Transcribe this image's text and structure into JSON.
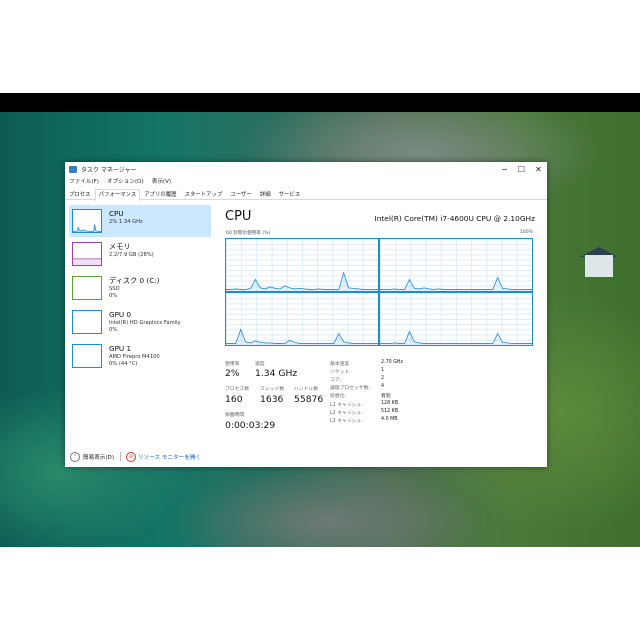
{
  "window": {
    "title": "タスク マネージャー",
    "controls": {
      "minimize": "─",
      "maximize": "☐",
      "close": "✕"
    }
  },
  "menu": [
    "ファイル(F)",
    "オプション(O)",
    "表示(V)"
  ],
  "tabs": [
    {
      "label": "プロセス",
      "active": false
    },
    {
      "label": "パフォーマンス",
      "active": true
    },
    {
      "label": "アプリの履歴",
      "active": false
    },
    {
      "label": "スタートアップ",
      "active": false
    },
    {
      "label": "ユーザー",
      "active": false
    },
    {
      "label": "詳細",
      "active": false
    },
    {
      "label": "サービス",
      "active": false
    }
  ],
  "sidebar": [
    {
      "name": "CPU",
      "line1": "2%  1.34 GHz",
      "line2": "",
      "color": "#1f8bd1"
    },
    {
      "name": "メモリ",
      "line1": "2.2/7.9 GB (28%)",
      "line2": "",
      "color": "#a23fb0"
    },
    {
      "name": "ディスク 0 (C:)",
      "line1": "SSD",
      "line2": "0%",
      "color": "#5aa33a"
    },
    {
      "name": "GPU 0",
      "line1": "Intel(R) HD Graphics Family",
      "line2": "0%",
      "color": "#1f8bd1"
    },
    {
      "name": "GPU 1",
      "line1": "AMD Firepro M4100",
      "line2": "0% (44 °C)",
      "color": "#1f8bd1"
    }
  ],
  "main": {
    "title": "CPU",
    "model": "Intel(R) Core(TM) i7-4600U CPU @ 2.10GHz",
    "usage_label": "60 秒間の使用率 (%)",
    "usage_max": "100%",
    "graphs": [
      [
        3,
        3,
        4,
        3,
        3,
        5,
        22,
        6,
        4,
        8,
        5,
        4,
        10,
        6,
        4,
        5,
        4,
        3,
        3,
        4,
        3,
        3,
        3,
        3,
        35,
        6,
        5,
        4,
        3,
        3,
        3,
        3
      ],
      [
        3,
        3,
        3,
        4,
        3,
        3,
        22,
        5,
        4,
        6,
        4,
        3,
        4,
        3,
        3,
        3,
        3,
        3,
        3,
        3,
        3,
        3,
        3,
        3,
        26,
        5,
        4,
        3,
        3,
        3,
        3,
        3
      ],
      [
        3,
        3,
        3,
        30,
        6,
        4,
        8,
        5,
        4,
        4,
        3,
        3,
        3,
        9,
        5,
        3,
        3,
        3,
        3,
        3,
        3,
        3,
        3,
        22,
        6,
        4,
        3,
        3,
        3,
        3,
        3,
        3
      ],
      [
        3,
        3,
        3,
        4,
        3,
        3,
        26,
        6,
        4,
        3,
        3,
        3,
        3,
        3,
        3,
        3,
        3,
        3,
        3,
        3,
        3,
        3,
        3,
        3,
        22,
        5,
        4,
        3,
        3,
        3,
        3,
        3
      ]
    ],
    "stats": {
      "utilization_label": "使用率",
      "utilization": "2%",
      "speed_label": "速度",
      "speed": "1.34 GHz",
      "processes_label": "プロセス数",
      "processes": "160",
      "threads_label": "スレッド数",
      "threads": "1636",
      "handles_label": "ハンドル数",
      "handles": "55876",
      "uptime_label": "稼働時間",
      "uptime": "0:00:03:29"
    },
    "specs": [
      {
        "label": "基本速度:",
        "value": "2.70 GHz"
      },
      {
        "label": "ソケット:",
        "value": "1"
      },
      {
        "label": "コア:",
        "value": "2"
      },
      {
        "label": "論理プロセッサ数:",
        "value": "4"
      },
      {
        "label": "仮想化:",
        "value": "有効"
      },
      {
        "label": "L1 キャッシュ:",
        "value": "128 KB"
      },
      {
        "label": "L2 キャッシュ:",
        "value": "512 KB"
      },
      {
        "label": "L3 キャッシュ:",
        "value": "4.0 MB"
      }
    ]
  },
  "footer": {
    "fewer_details": "簡易表示(D)",
    "resource_monitor": "リソース モニターを開く"
  }
}
